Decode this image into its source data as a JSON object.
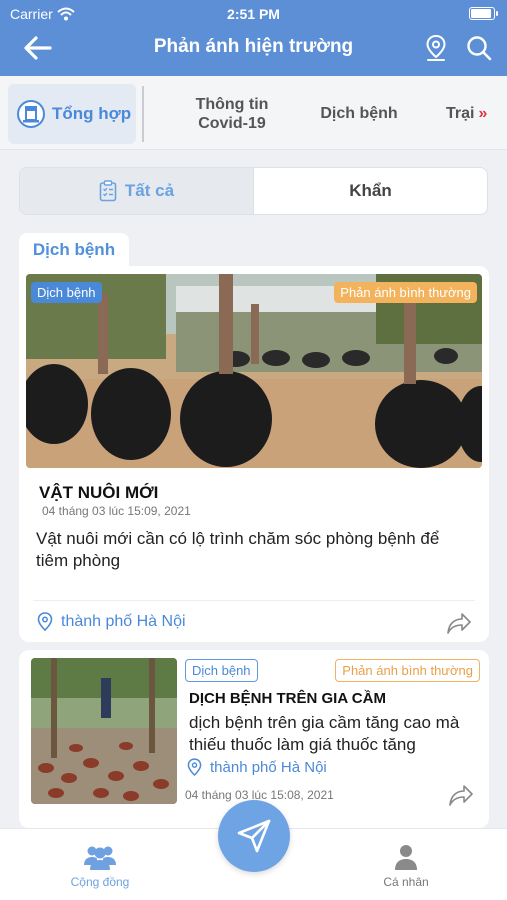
{
  "status_bar": {
    "carrier": "Carrier",
    "time": "2:51 PM"
  },
  "header": {
    "title": "Phản ánh hiện trường"
  },
  "category_tabs": {
    "active_label": "Tổng hợp",
    "items": [
      {
        "label": "Thông tin Covid-19"
      },
      {
        "label": "Dịch bệnh"
      },
      {
        "label": "Trại"
      }
    ]
  },
  "segment": {
    "all_label": "Tất cả",
    "urgent_label": "Khẩn"
  },
  "section": {
    "label": "Dịch bệnh"
  },
  "posts": [
    {
      "category": "Dịch bệnh",
      "status": "Phản ánh bình thường",
      "name": "VẬT NUÔI MỚI",
      "date": "04 tháng 03 lúc 15:09, 2021",
      "description": "Vật nuôi mới cần có lộ trình chăm sóc phòng bệnh để tiêm phòng",
      "location": "thành phố Hà Nội"
    },
    {
      "category": "Dịch bệnh",
      "status": "Phản ánh bình thường",
      "name": "DỊCH BỆNH TRÊN GIA CẦM",
      "description": "dịch bệnh trên gia cầm tăng cao mà thiếu thuốc làm giá thuốc tăng",
      "location": "thành phố Hà Nội",
      "date": "04 tháng 03 lúc 15:08, 2021"
    }
  ],
  "bottom_nav": {
    "community_label": "Cộng đồng",
    "profile_label": "Cá nhân"
  },
  "colors": {
    "primary": "#5c8fd6",
    "accent": "#4a89d8",
    "warning": "#f3b35c",
    "more_arrow": "#e0344a"
  }
}
